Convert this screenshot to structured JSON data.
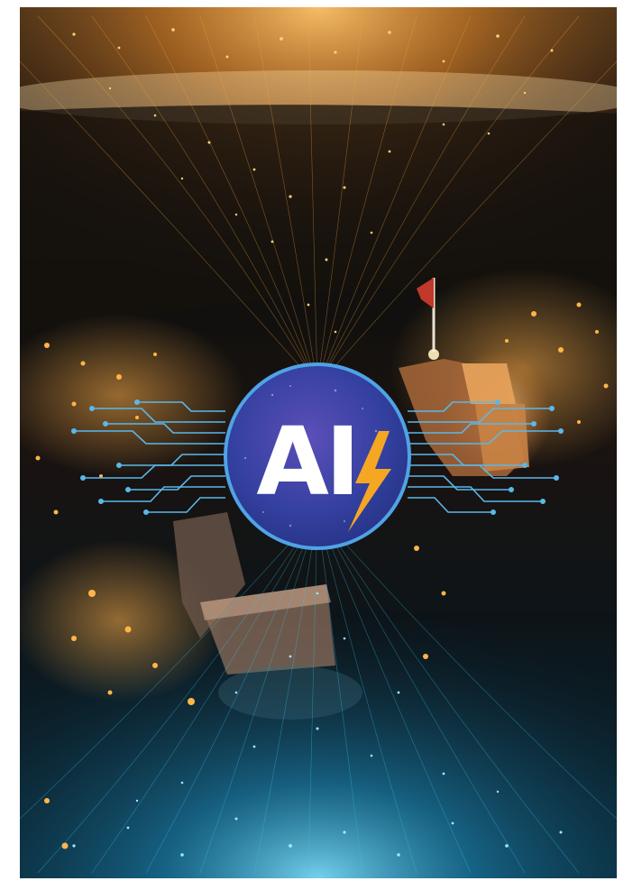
{
  "poster": {
    "logo": {
      "text": "AI",
      "icon": "lightning-bolt-icon"
    },
    "scene": {
      "flag_icon": "flag-icon"
    },
    "colors": {
      "orange_glow": "#f6a53a",
      "cyan_glow": "#38c6ee",
      "logo_circle": "#2f3f9e",
      "logo_border": "#4fa3e6",
      "circuit": "#5ab8ea",
      "bolt": "#f5a623",
      "flag": "#c0392b"
    }
  }
}
